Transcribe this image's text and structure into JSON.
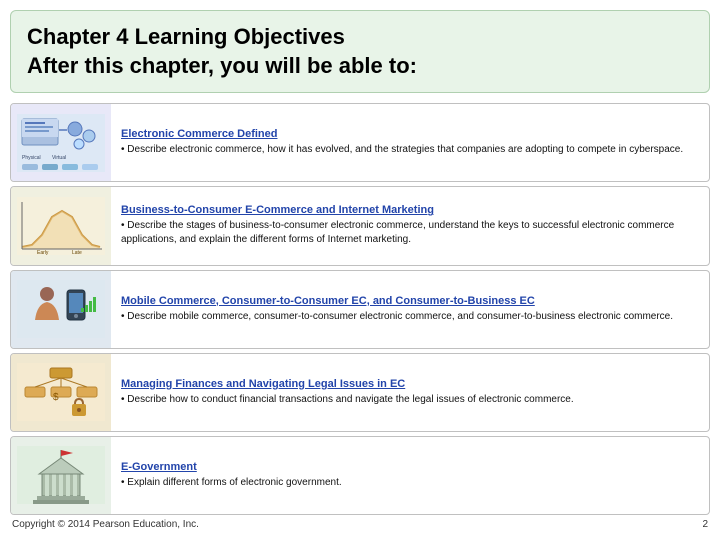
{
  "header": {
    "line1": "Chapter 4 Learning Objectives",
    "line2": "After this chapter, you will be able to:"
  },
  "objectives": [
    {
      "id": 1,
      "title": "Electronic Commerce Defined",
      "description": "• Describe electronic commerce, how it has evolved, and the strategies that companies are adopting to compete in cyberspace.",
      "thumb_class": "thumb-1"
    },
    {
      "id": 2,
      "title": "Business-to-Consumer E-Commerce and Internet Marketing",
      "description": "• Describe the stages of business-to-consumer electronic commerce, understand the keys to successful electronic commerce applications, and explain the different forms of Internet marketing.",
      "thumb_class": "thumb-2"
    },
    {
      "id": 3,
      "title": "Mobile Commerce, Consumer-to-Consumer EC, and Consumer-to-Business EC",
      "description": "• Describe mobile commerce, consumer-to-consumer electronic commerce, and consumer-to-business electronic commerce.",
      "thumb_class": "thumb-3"
    },
    {
      "id": 4,
      "title": "Managing Finances and Navigating Legal Issues in EC",
      "description": "• Describe how to conduct financial transactions and navigate the legal issues of electronic commerce.",
      "thumb_class": "thumb-4"
    },
    {
      "id": 5,
      "title": "E-Government",
      "description": "• Explain different forms of electronic government.",
      "thumb_class": "thumb-5"
    }
  ],
  "footer": {
    "copyright": "Copyright © 2014 Pearson Education, Inc.",
    "page": "2"
  }
}
